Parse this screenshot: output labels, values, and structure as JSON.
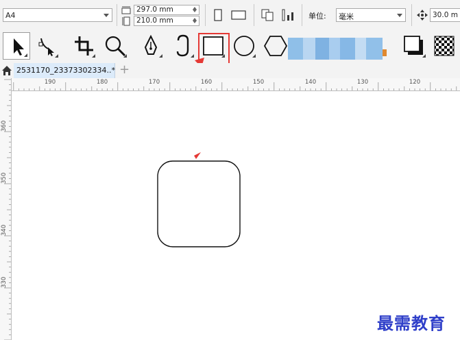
{
  "property_bar": {
    "page_size": "A4",
    "page_width": "297.0 mm",
    "page_height": "210.0 mm",
    "units_label": "单位:",
    "units_value": "毫米",
    "nudge_value": "30.0 m"
  },
  "toolbox": {
    "tools": [
      {
        "name": "pick-tool",
        "icon": "arrow-pointer-icon",
        "active": true
      },
      {
        "name": "shape-tool",
        "icon": "node-edit-icon"
      },
      {
        "name": "crop-tool",
        "icon": "crop-icon"
      },
      {
        "name": "zoom-tool",
        "icon": "magnifier-icon"
      },
      {
        "name": "pen-tool",
        "icon": "pen-nib-icon"
      },
      {
        "name": "artistic-media-tool",
        "icon": "curve-hook-icon"
      },
      {
        "name": "rectangle-tool",
        "icon": "rectangle-icon"
      },
      {
        "name": "ellipse-tool",
        "icon": "ellipse-icon"
      },
      {
        "name": "polygon-tool",
        "icon": "hexagon-icon"
      },
      {
        "name": "drop-shadow-tool",
        "icon": "shadow-icon"
      },
      {
        "name": "transparency-tool",
        "icon": "checkerboard-icon"
      }
    ]
  },
  "tabs": {
    "document": "2531170_23373302334..*",
    "add_tab": "+"
  },
  "ruler": {
    "horizontal_labels": [
      "190",
      "180",
      "170",
      "160",
      "150",
      "140",
      "130",
      "120"
    ],
    "vertical_labels": [
      "360",
      "350",
      "340",
      "330"
    ]
  },
  "watermark": "最需教育",
  "colors": {
    "highlight": "#e53935",
    "tab_active": "#dcebfa",
    "watermark": "#2f3fc9"
  }
}
